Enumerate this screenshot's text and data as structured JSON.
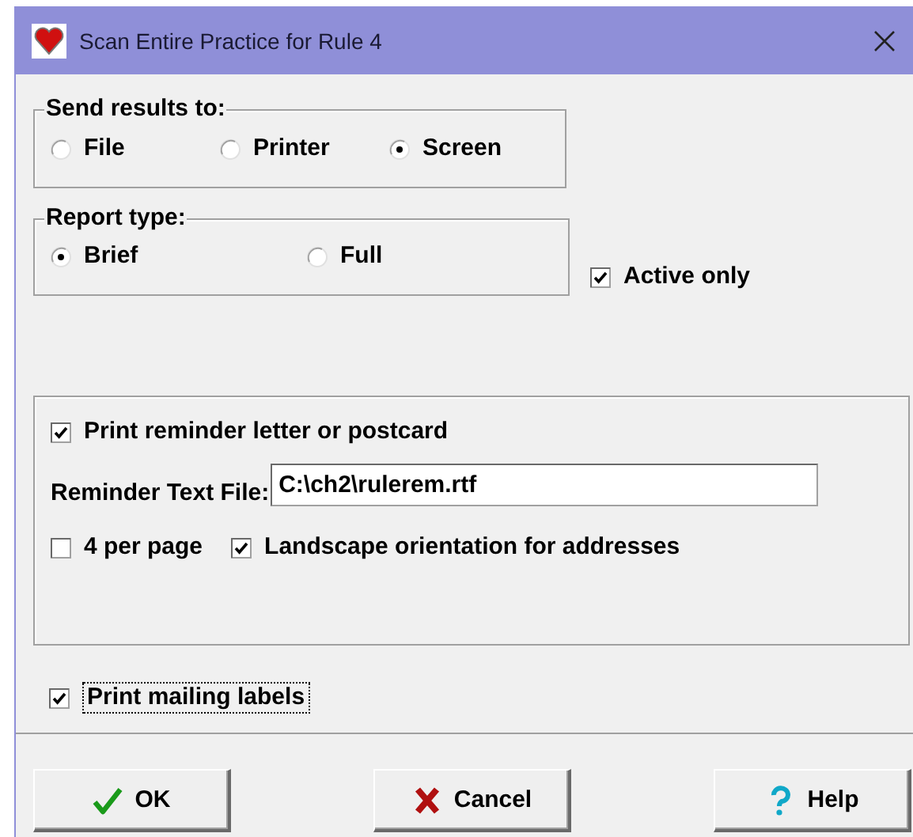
{
  "window": {
    "title": "Scan Entire Practice for Rule 4"
  },
  "send_results_to": {
    "label": "Send results to:",
    "options": [
      {
        "label": "File",
        "selected": false
      },
      {
        "label": "Printer",
        "selected": false
      },
      {
        "label": "Screen",
        "selected": true
      }
    ]
  },
  "report_type": {
    "label": "Report type:",
    "options": [
      {
        "label": "Brief",
        "selected": true
      },
      {
        "label": "Full",
        "selected": false
      }
    ]
  },
  "active_only": {
    "label": "Active only",
    "checked": true
  },
  "reminder": {
    "print": {
      "label": "Print reminder letter or postcard",
      "checked": true
    },
    "text_file": {
      "label": "Reminder Text File:",
      "value": "C:\\ch2\\rulerem.rtf"
    },
    "four_per_page": {
      "label": "4 per page",
      "checked": false
    },
    "landscape": {
      "label": "Landscape orientation for addresses",
      "checked": true
    }
  },
  "mailing_labels": {
    "label": "Print mailing labels",
    "checked": true,
    "focused": true
  },
  "buttons": [
    {
      "kind": "ok",
      "label": "OK"
    },
    {
      "kind": "cancel",
      "label": "Cancel"
    },
    {
      "kind": "help",
      "label": "Help"
    }
  ]
}
